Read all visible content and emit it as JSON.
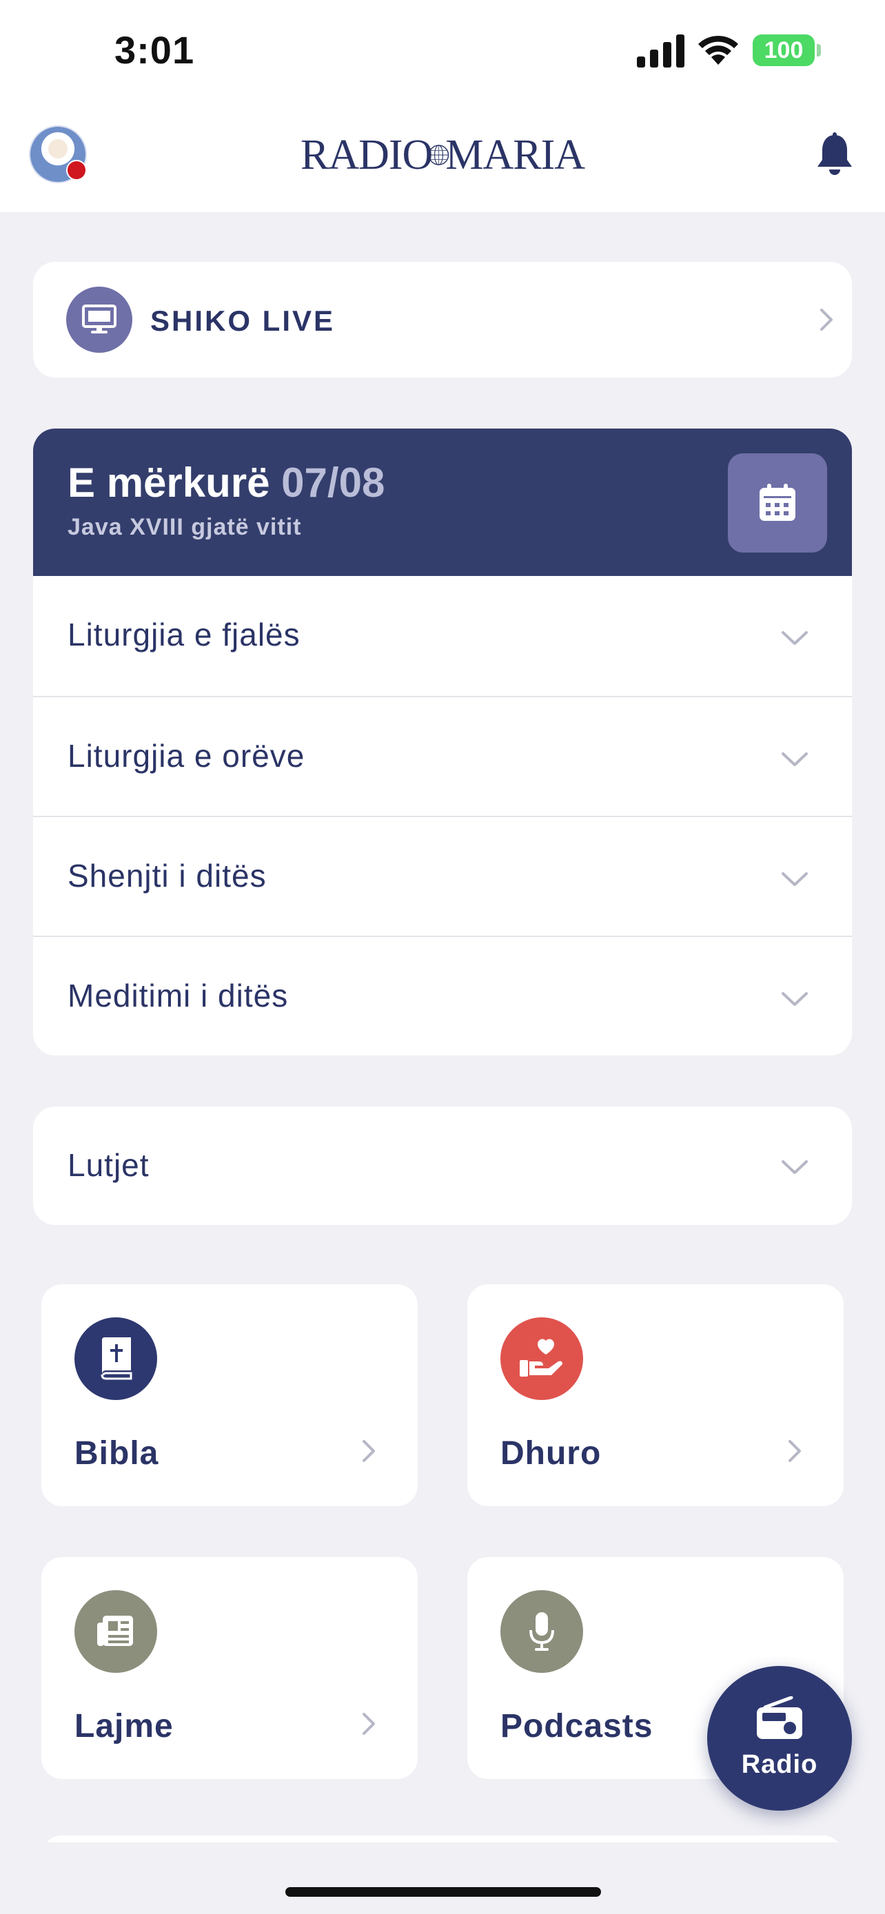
{
  "status_bar": {
    "time": "3:01",
    "battery": "100"
  },
  "header": {
    "logo_left": "RADIO",
    "logo_right": "MARIA",
    "icons": [
      "avatar",
      "bell-icon"
    ]
  },
  "live": {
    "label": "SHIKO LIVE",
    "icon": "monitor-icon"
  },
  "day": {
    "weekday": "E mërkurë",
    "date": "07/08",
    "subtitle": "Java XVIII gjatë vitit",
    "sections": [
      {
        "label": "Liturgjia e fjalës"
      },
      {
        "label": "Liturgjia e orëve"
      },
      {
        "label": "Shenjti i ditës"
      },
      {
        "label": "Meditimi i ditës"
      }
    ]
  },
  "prayers": {
    "label": "Lutjet"
  },
  "tiles": [
    {
      "label": "Bibla",
      "icon": "bible-icon",
      "color": "#2e3870"
    },
    {
      "label": "Dhuro",
      "icon": "donate-heart-icon",
      "color": "#e0534d"
    },
    {
      "label": "Lajme",
      "icon": "news-icon",
      "color": "#8b8f7c"
    },
    {
      "label": "Podcasts",
      "icon": "microphone-icon",
      "color": "#8b8f7c"
    }
  ],
  "fab": {
    "label": "Radio",
    "icon": "radio-icon"
  },
  "colors": {
    "primary": "#2b3466",
    "header_bg": "#343e6c",
    "accent": "#6f70a8",
    "background": "#f0f0f5"
  }
}
